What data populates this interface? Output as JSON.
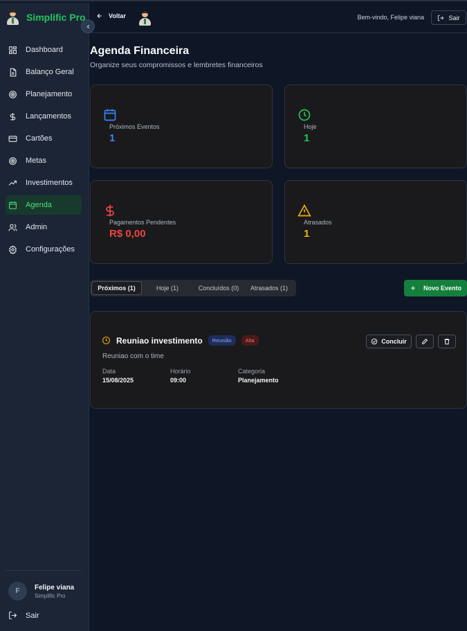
{
  "app": {
    "brand": "Simplific Pro"
  },
  "sidebar": {
    "items": [
      {
        "label": "Dashboard",
        "icon": "dashboard-icon"
      },
      {
        "label": "Balanço Geral",
        "icon": "document-icon"
      },
      {
        "label": "Planejamento",
        "icon": "target-icon"
      },
      {
        "label": "Lançamentos",
        "icon": "dollar-icon"
      },
      {
        "label": "Cartões",
        "icon": "credit-card-icon"
      },
      {
        "label": "Metas",
        "icon": "target-icon"
      },
      {
        "label": "Investimentos",
        "icon": "trending-up-icon"
      },
      {
        "label": "Agenda",
        "icon": "calendar-icon",
        "active": true
      },
      {
        "label": "Admin",
        "icon": "users-icon"
      },
      {
        "label": "Configurações",
        "icon": "gear-icon"
      }
    ],
    "user": {
      "initial": "F",
      "name": "Felipe viana",
      "plan": "Simplific Pro"
    },
    "logout_label": "Sair"
  },
  "topbar": {
    "back_label": "Voltar",
    "welcome": "Bem-vindo, Felipe viana",
    "logout_label": "Sair"
  },
  "page": {
    "title": "Agenda Financeira",
    "subtitle": "Organize seus compromissos e lembretes financeiros"
  },
  "stats": [
    {
      "label": "Próximos Eventos",
      "value": "1",
      "color": "#3b82f6",
      "icon": "calendar-icon"
    },
    {
      "label": "Hoje",
      "value": "1",
      "color": "#22c55e",
      "icon": "clock-icon"
    },
    {
      "label": "Pagamentos Pendentes",
      "value": "R$ 0,00",
      "color": "#ef4444",
      "icon": "dollar-icon"
    },
    {
      "label": "Atrasados",
      "value": "1",
      "color": "#eab308",
      "icon": "warning-icon"
    }
  ],
  "tabs": [
    {
      "label": "Próximos (1)",
      "active": true
    },
    {
      "label": "Hoje (1)"
    },
    {
      "label": "Concluídos (0)"
    },
    {
      "label": "Atrasados (1)"
    }
  ],
  "new_event_label": "Novo Evento",
  "event": {
    "title": "Reuniao investimento",
    "type_badge": "Reunião",
    "priority_badge": "Alta",
    "description": "Reuniao com o time",
    "date_label": "Data",
    "date": "15/08/2025",
    "time_label": "Horário",
    "time": "09:00",
    "category_label": "Categoria",
    "category": "Planejamento",
    "complete_label": "Concluir"
  },
  "colors": {
    "accent_green": "#22c55e",
    "active_nav_bg": "#173a2c",
    "primary_button": "#15803d"
  }
}
